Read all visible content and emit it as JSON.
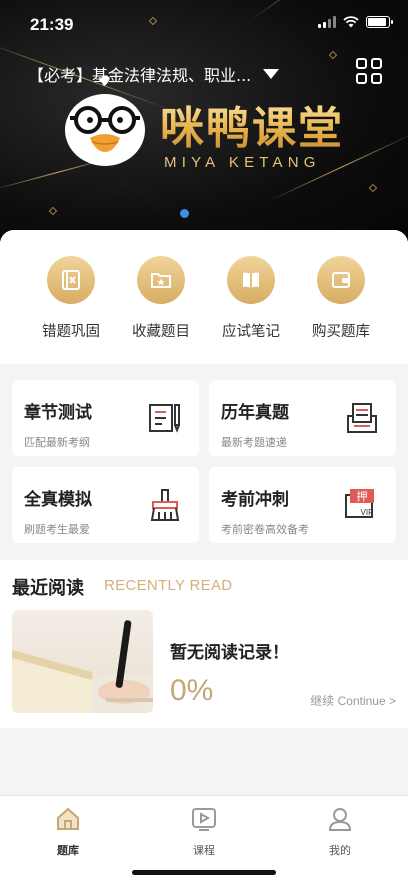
{
  "status": {
    "time": "21:39"
  },
  "banner": {
    "exam_selector": "【必考】基金法律法规、职业...",
    "brand_cn": "咪鸭课堂",
    "brand_en": "MIYA KETANG"
  },
  "quick_actions": [
    {
      "label": "错题巩固",
      "icon": "wrong-questions-icon"
    },
    {
      "label": "收藏题目",
      "icon": "favorite-folder-icon"
    },
    {
      "label": "应试笔记",
      "icon": "notes-book-icon"
    },
    {
      "label": "购买题库",
      "icon": "wallet-icon"
    }
  ],
  "cards": [
    {
      "title": "章节测试",
      "subtitle": "匹配最新考纲",
      "icon": "chapter-test-icon"
    },
    {
      "title": "历年真题",
      "subtitle": "最新考题速递",
      "icon": "past-exams-icon"
    },
    {
      "title": "全真模拟",
      "subtitle": "刷题考生最爱",
      "icon": "mock-exam-icon"
    },
    {
      "title": "考前冲刺",
      "subtitle": "考前密卷高效备考",
      "icon": "sprint-icon",
      "badge_text": "押",
      "badge_vip": "VIP"
    }
  ],
  "recent": {
    "title": "最近阅读",
    "title_en": "RECENTLY READ",
    "empty_text": "暂无阅读记录！",
    "progress": "0%",
    "continue": "继续 Continue >"
  },
  "tabs": [
    {
      "label": "题库",
      "icon": "question-bank-icon",
      "active": true
    },
    {
      "label": "课程",
      "icon": "course-play-icon",
      "active": false
    },
    {
      "label": "我的",
      "icon": "profile-icon",
      "active": false
    }
  ],
  "colors": {
    "gold": "#d8ad62",
    "accent_text": "#c5a679",
    "indicator": "#3a8ee6"
  }
}
